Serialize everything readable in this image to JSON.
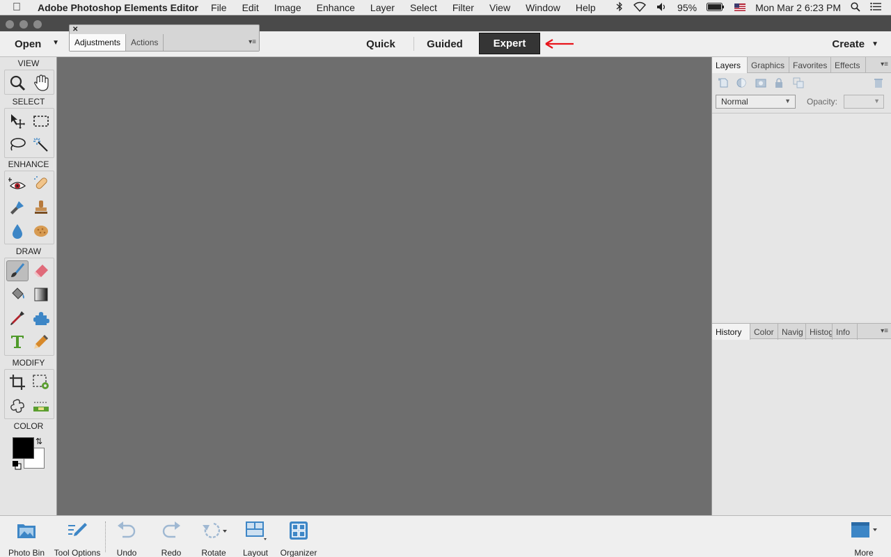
{
  "menubar": {
    "app_name": "Adobe Photoshop Elements Editor",
    "items": [
      "File",
      "Edit",
      "Image",
      "Enhance",
      "Layer",
      "Select",
      "Filter",
      "View",
      "Window",
      "Help"
    ],
    "battery": "95%",
    "datetime": "Mon Mar 2  6:23 PM"
  },
  "appbar": {
    "open_label": "Open",
    "modes": [
      "Quick",
      "Guided",
      "Expert"
    ],
    "active_mode": "Expert",
    "create_label": "Create"
  },
  "float_panel": {
    "tabs": [
      "Adjustments",
      "Actions"
    ],
    "active_tab": "Adjustments"
  },
  "toolbox": {
    "sections": [
      "VIEW",
      "SELECT",
      "ENHANCE",
      "DRAW",
      "MODIFY",
      "COLOR"
    ],
    "tools": {
      "view": [
        "zoom-tool",
        "hand-tool"
      ],
      "select": [
        "move-tool",
        "marquee-tool",
        "lasso-tool",
        "magic-wand-tool"
      ],
      "enhance": [
        "red-eye-tool",
        "healing-tool",
        "smart-brush-tool",
        "clone-stamp-tool",
        "blur-tool",
        "sponge-tool"
      ],
      "draw": [
        "brush-tool",
        "eraser-tool",
        "paint-bucket-tool",
        "gradient-tool",
        "eyedropper-tool",
        "custom-shape-tool",
        "type-tool",
        "pencil-tool"
      ],
      "modify": [
        "crop-tool",
        "recompose-tool",
        "content-aware-move-tool",
        "straighten-tool"
      ]
    },
    "foreground_color": "#000000",
    "background_color": "#ffffff"
  },
  "layers_panel": {
    "tabs": [
      "Layers",
      "Graphics",
      "Favorites",
      "Effects"
    ],
    "active_tab": "Layers",
    "blend_mode": "Normal",
    "opacity_label": "Opacity:"
  },
  "history_panel": {
    "tabs": [
      "History",
      "Color",
      "Navig",
      "Histog",
      "Info"
    ],
    "active_tab": "History"
  },
  "taskbar": {
    "photo_bin": "Photo Bin",
    "tool_options": "Tool Options",
    "undo": "Undo",
    "redo": "Redo",
    "rotate": "Rotate",
    "layout": "Layout",
    "organizer": "Organizer",
    "more": "More"
  },
  "colors": {
    "canvas": "#6e6e6e",
    "expert_bg": "#353535",
    "annotation_arrow": "#e8141b",
    "icon_blue": "#3d86c6"
  }
}
